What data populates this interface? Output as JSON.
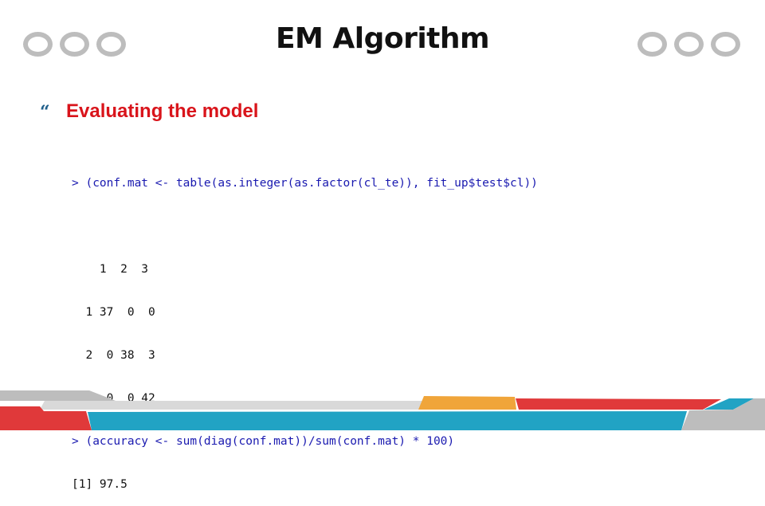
{
  "slide": {
    "title": "EM Algorithm",
    "bullet_icon": "quote-icon",
    "bullet_text": "Evaluating the model",
    "decor": {
      "ring_color": "#bdbdbd",
      "footer_colors": {
        "red": "#e0393a",
        "blue": "#21a3c4",
        "orange": "#f0a53a",
        "gray_dark": "#bdbdbd",
        "gray_light": "#d9d9d9"
      }
    }
  },
  "console": {
    "prompt": ">",
    "command1": "(conf.mat <- table(as.integer(as.factor(cl_te)), fit_up$test$cl))",
    "table_header": "    1  2  3",
    "table_rows": [
      "  1 37  0  0",
      "  2  0 38  3",
      "  3  0  0 42"
    ],
    "command2": "(accuracy <- sum(diag(conf.mat))/sum(conf.mat) * 100)",
    "result": "[1] 97.5"
  }
}
